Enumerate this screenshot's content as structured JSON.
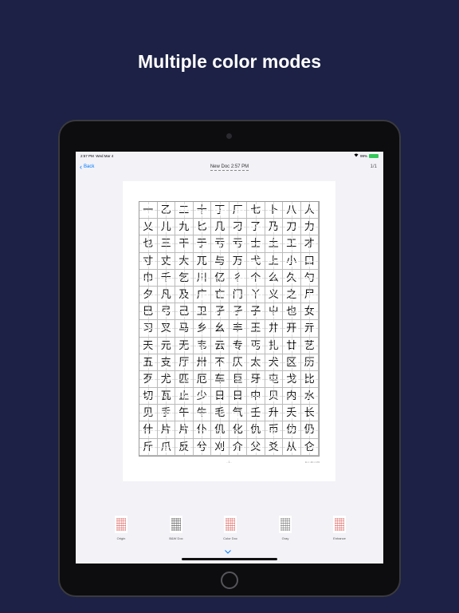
{
  "headline": "Multiple color modes",
  "status_bar": {
    "time": "2:57 PM",
    "date": "Wed Mar 4",
    "battery": "99%",
    "battery_fill": 0.99,
    "wifi_icon": "wifi-icon"
  },
  "nav": {
    "back_label": "Back",
    "title": "New Doc 2:57 PM",
    "page_counter": "1/1"
  },
  "document": {
    "rows": [
      [
        "一",
        "乙",
        "二",
        "十",
        "丁",
        "厂",
        "七",
        "卜",
        "八",
        "人",
        "入"
      ],
      [
        "乂",
        "儿",
        "九",
        "匕",
        "几",
        "刁",
        "了",
        "乃",
        "刀",
        "力",
        "又"
      ],
      [
        "乜",
        "三",
        "干",
        "于",
        "亏",
        "亏",
        "士",
        "土",
        "工",
        "才",
        "下"
      ],
      [
        "寸",
        "丈",
        "大",
        "兀",
        "与",
        "万",
        "弋",
        "上",
        "小",
        "口",
        "山"
      ],
      [
        "巾",
        "千",
        "乞",
        "川",
        "亿",
        "彳",
        "个",
        "么",
        "久",
        "勺",
        "丸"
      ],
      [
        "夕",
        "凡",
        "及",
        "广",
        "亡",
        "门",
        "丫",
        "义",
        "之",
        "尸",
        "已"
      ],
      [
        "巳",
        "弓",
        "己",
        "卫",
        "孑",
        "孑",
        "子",
        "屮",
        "也",
        "女",
        "飞",
        "刃"
      ],
      [
        "习",
        "叉",
        "马",
        "乡",
        "幺",
        "丰",
        "王",
        "井",
        "开",
        "亓",
        "夫"
      ],
      [
        "天",
        "元",
        "无",
        "韦",
        "云",
        "专",
        "丐",
        "扎",
        "廿",
        "艺",
        "木"
      ],
      [
        "五",
        "支",
        "厅",
        "卅",
        "不",
        "仄",
        "太",
        "犬",
        "区",
        "历",
        "友"
      ],
      [
        "歹",
        "尤",
        "匹",
        "厄",
        "车",
        "巨",
        "牙",
        "屯",
        "戈",
        "比",
        "互"
      ],
      [
        "切",
        "瓦",
        "止",
        "少",
        "日",
        "日",
        "中",
        "贝",
        "内",
        "水",
        "冈"
      ],
      [
        "见",
        "手",
        "午",
        "牛",
        "毛",
        "气",
        "壬",
        "升",
        "夭",
        "长",
        "仁"
      ],
      [
        "什",
        "片",
        "片",
        "仆",
        "仉",
        "化",
        "仇",
        "币",
        "仂",
        "仍",
        "仅"
      ],
      [
        "斤",
        "爪",
        "反",
        "兮",
        "刈",
        "介",
        "父",
        "爻",
        "从",
        "仑",
        "今"
      ]
    ],
    "footer_center": "- 1 -",
    "footer_right": "11 × 16 × 176"
  },
  "modes": [
    {
      "label": "Origin",
      "tint": "#d9534f"
    },
    {
      "label": "B&W Doc",
      "tint": "#444444"
    },
    {
      "label": "Color Doc",
      "tint": "#d9534f"
    },
    {
      "label": "Gray",
      "tint": "#666666"
    },
    {
      "label": "Enhance",
      "tint": "#d9534f"
    }
  ],
  "icons": {
    "back": "chevron-left-icon",
    "expand": "chevron-down-icon"
  }
}
